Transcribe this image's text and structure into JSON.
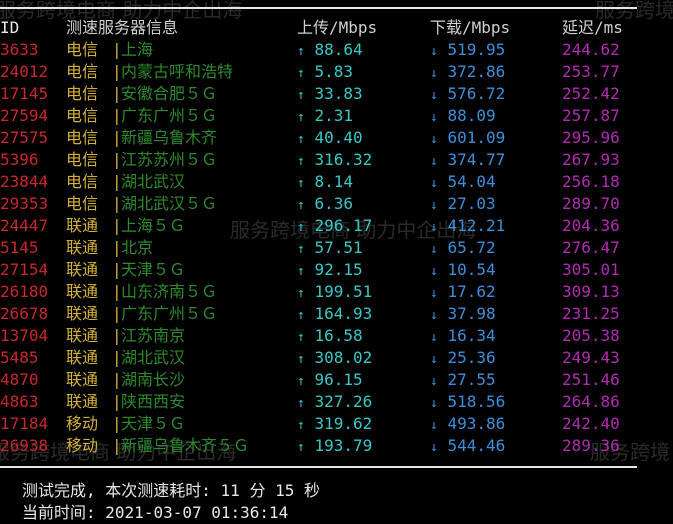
{
  "watermark": {
    "slogan": "服务跨境电商 助力中企出海",
    "slogan_short": "服务跨境"
  },
  "header": {
    "id": "ID",
    "server": "测速服务器信息",
    "upload": "上传/Mbps",
    "download": "下载/Mbps",
    "latency": "延迟/ms"
  },
  "symbols": {
    "up": "↑",
    "down": "↓",
    "sep": "|"
  },
  "rows": [
    {
      "id": "3633",
      "isp": "电信",
      "loc": "上海",
      "up": "88.64",
      "down": "519.95",
      "lat": "244.62"
    },
    {
      "id": "24012",
      "isp": "电信",
      "loc": "内蒙古呼和浩特",
      "up": "5.83",
      "down": "372.86",
      "lat": "253.77"
    },
    {
      "id": "17145",
      "isp": "电信",
      "loc": "安徽合肥５Ｇ",
      "up": "33.83",
      "down": "576.72",
      "lat": "252.42"
    },
    {
      "id": "27594",
      "isp": "电信",
      "loc": "广东广州５Ｇ",
      "up": "2.31",
      "down": "88.09",
      "lat": "257.87"
    },
    {
      "id": "27575",
      "isp": "电信",
      "loc": "新疆乌鲁木齐",
      "up": "40.40",
      "down": "601.09",
      "lat": "295.96"
    },
    {
      "id": "5396",
      "isp": "电信",
      "loc": "江苏苏州５Ｇ",
      "up": "316.32",
      "down": "374.77",
      "lat": "267.93"
    },
    {
      "id": "23844",
      "isp": "电信",
      "loc": "湖北武汉",
      "up": "8.14",
      "down": "54.04",
      "lat": "256.18"
    },
    {
      "id": "29353",
      "isp": "电信",
      "loc": "湖北武汉５Ｇ",
      "up": "6.36",
      "down": "27.03",
      "lat": "289.70"
    },
    {
      "id": "24447",
      "isp": "联通",
      "loc": "上海５Ｇ",
      "up": "296.17",
      "down": "412.21",
      "lat": "204.36"
    },
    {
      "id": "5145",
      "isp": "联通",
      "loc": "北京",
      "up": "57.51",
      "down": "65.72",
      "lat": "276.47"
    },
    {
      "id": "27154",
      "isp": "联通",
      "loc": "天津５Ｇ",
      "up": "92.15",
      "down": "10.54",
      "lat": "305.01"
    },
    {
      "id": "26180",
      "isp": "联通",
      "loc": "山东济南５Ｇ",
      "up": "199.51",
      "down": "17.62",
      "lat": "309.13"
    },
    {
      "id": "26678",
      "isp": "联通",
      "loc": "广东广州５Ｇ",
      "up": "164.93",
      "down": "37.98",
      "lat": "231.25"
    },
    {
      "id": "13704",
      "isp": "联通",
      "loc": "江苏南京",
      "up": "16.58",
      "down": "16.34",
      "lat": "205.38"
    },
    {
      "id": "5485",
      "isp": "联通",
      "loc": "湖北武汉",
      "up": "308.02",
      "down": "25.36",
      "lat": "249.43"
    },
    {
      "id": "4870",
      "isp": "联通",
      "loc": "湖南长沙",
      "up": "96.15",
      "down": "27.55",
      "lat": "251.46"
    },
    {
      "id": "4863",
      "isp": "联通",
      "loc": "陕西西安",
      "up": "327.26",
      "down": "518.56",
      "lat": "264.86"
    },
    {
      "id": "17184",
      "isp": "移动",
      "loc": "天津５Ｇ",
      "up": "319.62",
      "down": "493.86",
      "lat": "242.40"
    },
    {
      "id": "26938",
      "isp": "移动",
      "loc": "新疆乌鲁木齐５Ｇ",
      "up": "193.79",
      "down": "544.46",
      "lat": "289.36"
    }
  ],
  "footer": {
    "done_label": "测试完成, 本次测速耗时:",
    "minutes": "11",
    "min_unit": "分",
    "seconds": "15",
    "sec_unit": "秒",
    "time_label": "当前时间:",
    "time": "2021-03-07 01:36:14"
  }
}
